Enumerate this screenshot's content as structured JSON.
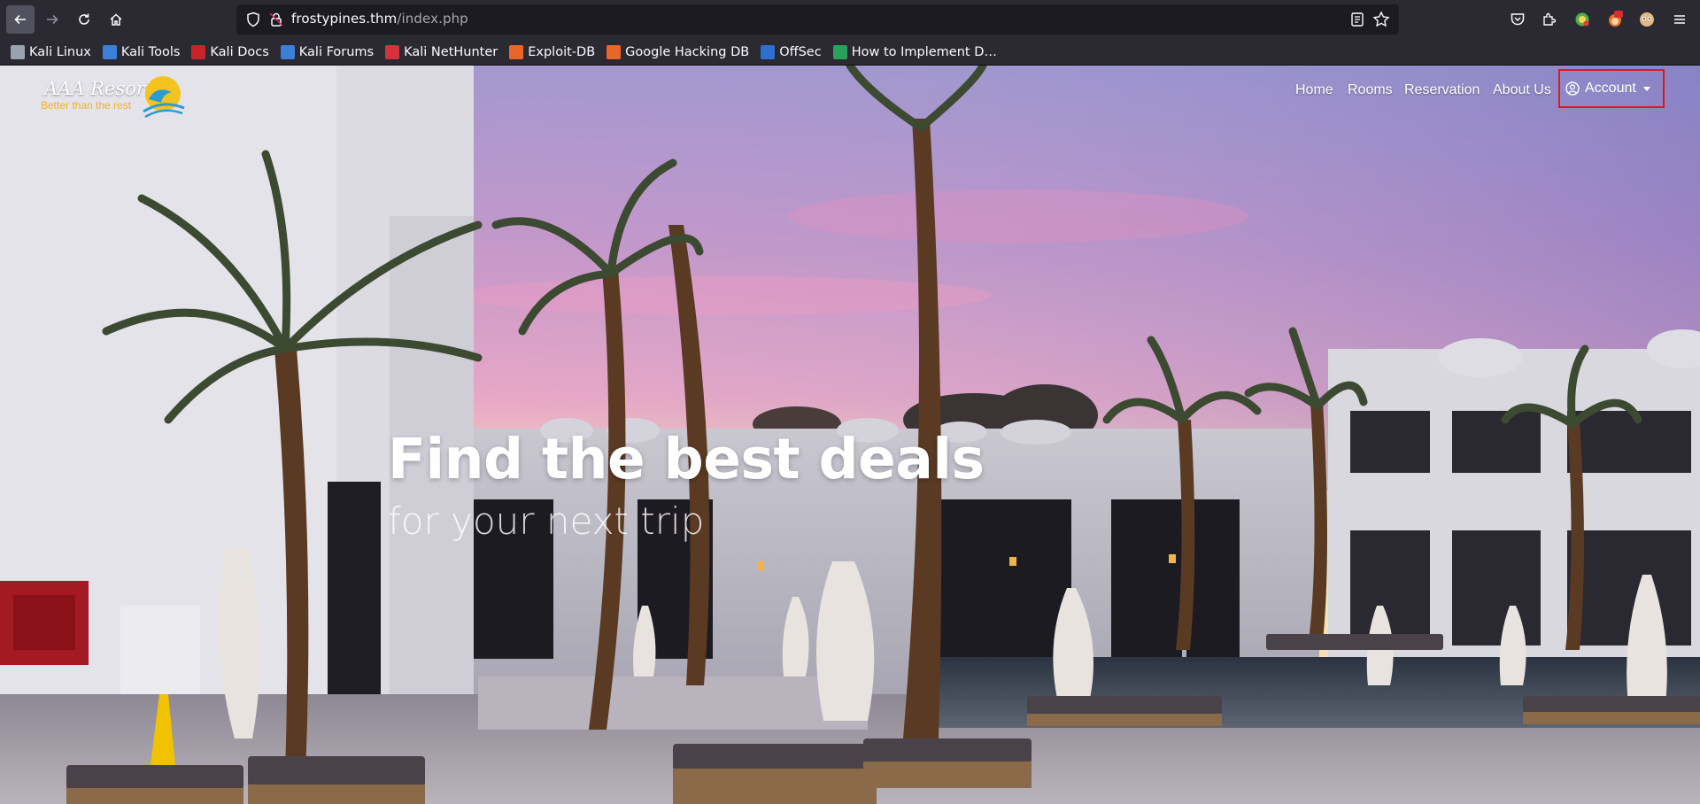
{
  "browser": {
    "url_host": "frostypines.thm",
    "url_path": "/index.php",
    "bookmarks": [
      {
        "label": "Kali Linux",
        "color": "#9aa3ad"
      },
      {
        "label": "Kali Tools",
        "color": "#3b7fd6"
      },
      {
        "label": "Kali Docs",
        "color": "#c9232a"
      },
      {
        "label": "Kali Forums",
        "color": "#3b7fd6"
      },
      {
        "label": "Kali NetHunter",
        "color": "#d6323a"
      },
      {
        "label": "Exploit-DB",
        "color": "#e8662a"
      },
      {
        "label": "Google Hacking DB",
        "color": "#e8662a"
      },
      {
        "label": "OffSec",
        "color": "#2f6fd0"
      },
      {
        "label": "How to Implement D…",
        "color": "#2aa15a"
      }
    ]
  },
  "site": {
    "brand": "AAA Resorts",
    "tagline": "Better than the rest",
    "nav": {
      "home": "Home",
      "rooms": "Rooms",
      "reservation": "Reservation",
      "about": "About Us",
      "account": "Account"
    },
    "hero": {
      "title": "Find the best deals",
      "subtitle": "for your next trip"
    }
  }
}
